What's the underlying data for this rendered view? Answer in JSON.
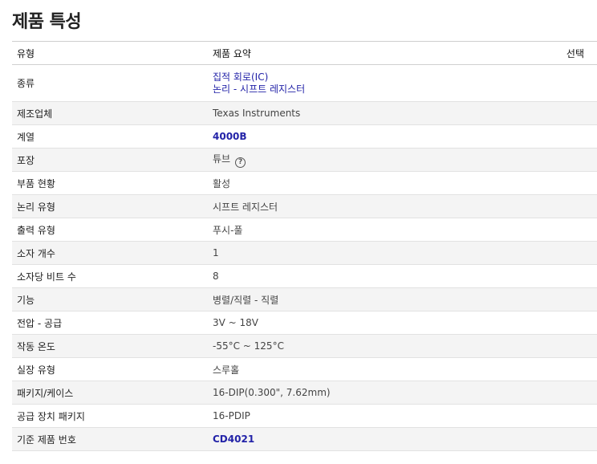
{
  "title": "제품 특성",
  "headers": {
    "type": "유형",
    "summary": "제품 요약",
    "select": "선택"
  },
  "rows": {
    "category": {
      "label": "종류",
      "value1": "집적 회로(IC)",
      "value2": "논리 - 시프트 레지스터"
    },
    "manufacturer": {
      "label": "제조업체",
      "value": "Texas Instruments"
    },
    "series": {
      "label": "계열",
      "value": "4000B"
    },
    "packaging": {
      "label": "포장",
      "value": "튜브",
      "help_icon": "?"
    },
    "part_status": {
      "label": "부품 현황",
      "value": "활성"
    },
    "logic_type": {
      "label": "논리 유형",
      "value": "시프트 레지스터"
    },
    "output_type": {
      "label": "출력 유형",
      "value": "푸시-풀"
    },
    "num_elements": {
      "label": "소자 개수",
      "value": "1"
    },
    "bits_per_element": {
      "label": "소자당 비트 수",
      "value": "8"
    },
    "function": {
      "label": "기능",
      "value": "병렬/직렬 - 직렬"
    },
    "voltage_supply": {
      "label": "전압 - 공급",
      "value": "3V ~ 18V"
    },
    "operating_temp": {
      "label": "작동 온도",
      "value": "-55°C ~ 125°C"
    },
    "mounting_type": {
      "label": "실장 유형",
      "value": "스루홀"
    },
    "package_case": {
      "label": "패키지/케이스",
      "value": "16-DIP(0.300\", 7.62mm)"
    },
    "supplier_device_package": {
      "label": "공급 장치 패키지",
      "value": "16-PDIP"
    },
    "base_product_number": {
      "label": "기준 제품 번호",
      "value": "CD4021"
    }
  }
}
